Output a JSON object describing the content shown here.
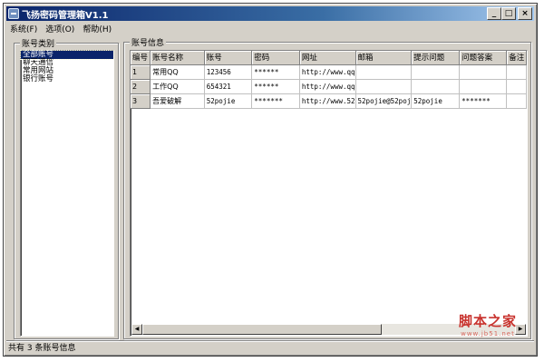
{
  "window": {
    "title": "飞扬密码管理箱V1.1",
    "buttons": {
      "minimize": "_",
      "maximize": "□",
      "close": "×"
    }
  },
  "menu": [
    {
      "label": "系统(F)"
    },
    {
      "label": "选项(O)"
    },
    {
      "label": "帮助(H)"
    }
  ],
  "categories": {
    "title": "账号类别",
    "items": [
      "全部账号",
      "聊天通信",
      "常用网站",
      "银行账号"
    ],
    "selected_index": 0
  },
  "accounts": {
    "title": "账号信息",
    "columns": [
      "编号",
      "账号名称",
      "账号",
      "密码",
      "网址",
      "邮箱",
      "提示问题",
      "问题答案",
      "备注"
    ],
    "rows": [
      [
        "1",
        "常用QQ",
        "123456",
        "******",
        "http://www.qq",
        "",
        "",
        "",
        ""
      ],
      [
        "2",
        "工作QQ",
        "654321",
        "******",
        "http://www.qq",
        "",
        "",
        "",
        ""
      ],
      [
        "3",
        "吾爱破解",
        "52pojie",
        "*******",
        "http://www.52",
        "52pojie@52poj",
        "52pojie",
        "*******",
        ""
      ]
    ]
  },
  "statusbar": {
    "text": "共有 3 条账号信息"
  },
  "watermark": {
    "main": "脚本之家",
    "sub": "www.jb51.net"
  },
  "colors": {
    "title_start": "#0a246a",
    "title_end": "#a6caf0",
    "face": "#d4d0c8",
    "selection": "#0a246a",
    "watermark": "#c8322d"
  }
}
